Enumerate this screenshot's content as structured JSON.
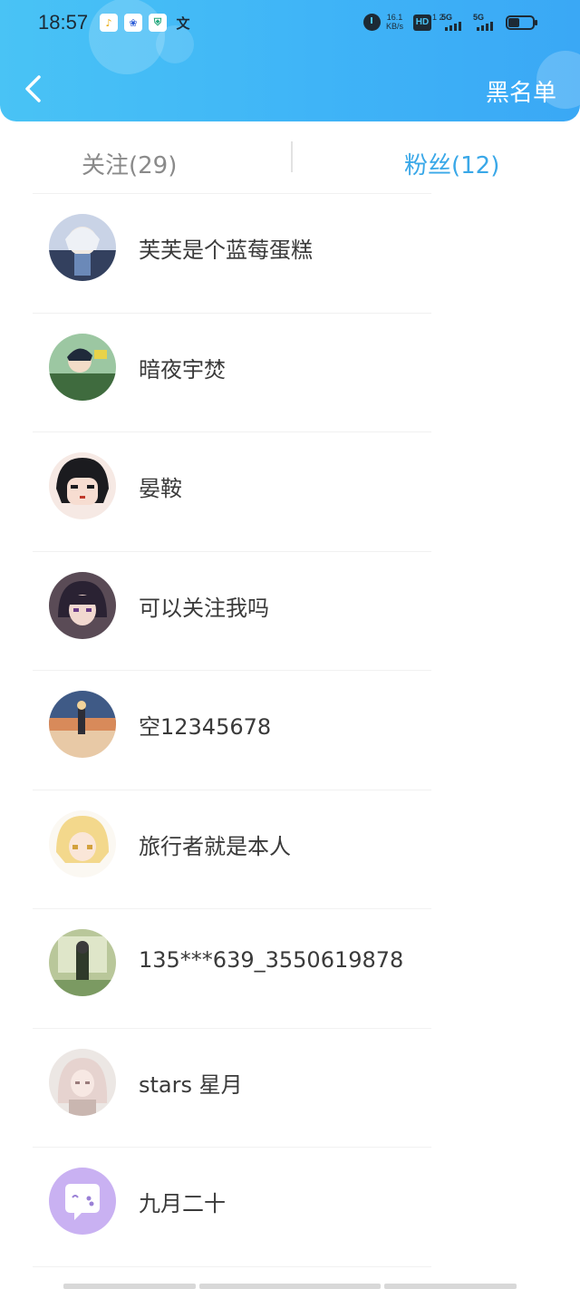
{
  "status_bar": {
    "time": "18:57",
    "app_icons": [
      "reader-icon",
      "baidu-icon",
      "security-icon",
      "translate-icon"
    ],
    "app_icon_glyphs": [
      "♪",
      "❀",
      "⛨",
      "文"
    ],
    "net_speed_value": "16.1",
    "net_speed_unit": "KB/s",
    "hd_label": "HD",
    "hd_num": "1 2",
    "signal1_label": "5G",
    "signal2_label": "5G"
  },
  "header": {
    "back_icon": "chevron-left-icon",
    "action_label": "黑名单",
    "colors": {
      "start": "#49c3f5",
      "end": "#3aa8f5"
    }
  },
  "tabs": [
    {
      "label": "关注(29)",
      "active": false
    },
    {
      "label": "粉丝(12)",
      "active": true
    }
  ],
  "accent_color": "#3aa8e8",
  "fans": [
    {
      "name": "芙芙是个蓝莓蛋糕",
      "avatar": "anime-white-hair-avatar"
    },
    {
      "name": "暗夜宇焚",
      "avatar": "anime-green-archer-avatar"
    },
    {
      "name": "晏鞍",
      "avatar": "anime-chibi-dark-hair-avatar"
    },
    {
      "name": "可以关注我吗",
      "avatar": "anime-purple-hair-avatar"
    },
    {
      "name": "空12345678",
      "avatar": "sunset-traveler-avatar"
    },
    {
      "name": "旅行者就是本人",
      "avatar": "anime-blonde-avatar"
    },
    {
      "name": "135***639_3550619878",
      "avatar": "anime-green-forest-avatar"
    },
    {
      "name": "stars 星月",
      "avatar": "doll-girl-avatar"
    },
    {
      "name": "九月二十",
      "avatar": "default-chat-bubble-avatar"
    }
  ]
}
